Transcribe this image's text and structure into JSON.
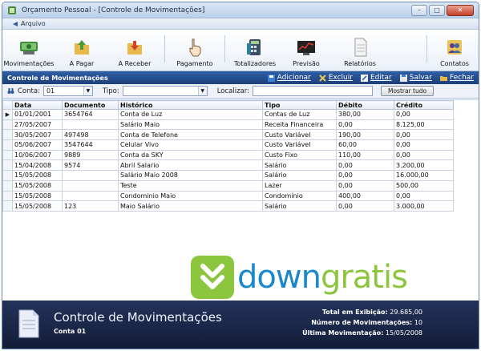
{
  "window": {
    "title": "Orçamento Pessoal - [Controle de Movimentações]",
    "min": "–",
    "max": "□",
    "close": "✕"
  },
  "menu": {
    "arquivo": "Arquivo"
  },
  "toolbar": {
    "buttons": [
      {
        "label": "Movimentações",
        "icon": "money-icon"
      },
      {
        "label": "A Pagar",
        "icon": "folder-up-icon"
      },
      {
        "label": "A Receber",
        "icon": "folder-down-icon"
      },
      {
        "label": "Pagamento",
        "icon": "hand-pointer-icon"
      },
      {
        "label": "Totalizadores",
        "icon": "calculator-icon"
      },
      {
        "label": "Previsão",
        "icon": "chart-screen-icon"
      },
      {
        "label": "Relatórios",
        "icon": "document-icon"
      },
      {
        "label": "Contatos",
        "icon": "contacts-icon"
      }
    ]
  },
  "section": {
    "title": "Controle de Movimentações",
    "actions": {
      "add": "Adicionar",
      "delete": "Excluir",
      "edit": "Editar",
      "save": "Salvar",
      "close": "Fechar"
    }
  },
  "filters": {
    "conta_label": "Conta:",
    "conta_value": "01",
    "tipo_label": "Tipo:",
    "tipo_value": "",
    "localizar_label": "Localizar:",
    "localizar_value": "",
    "show_all": "Mostrar tudo"
  },
  "grid": {
    "columns": [
      "Data",
      "Documento",
      "Histórico",
      "Tipo",
      "Débito",
      "Crédito"
    ],
    "rows": [
      [
        "01/01/2001",
        "3654764",
        "Conta de Luz",
        "Contas de Luz",
        "380,00",
        "0,00"
      ],
      [
        "27/05/2007",
        "",
        "Salário Maio",
        "Receita Financeira",
        "0,00",
        "8.125,00"
      ],
      [
        "30/05/2007",
        "497498",
        "Conta de Telefone",
        "Custo Variável",
        "190,00",
        "0,00"
      ],
      [
        "05/06/2007",
        "3547644",
        "Celular Vivo",
        "Custo Variável",
        "60,00",
        "0,00"
      ],
      [
        "10/06/2007",
        "9889",
        "Conta da SKY",
        "Custo Fixo",
        "110,00",
        "0,00"
      ],
      [
        "15/04/2008",
        "9574",
        "Abril Salario",
        "Salário",
        "0,00",
        "3.200,00"
      ],
      [
        "15/05/2008",
        "",
        "Salário Maio 2008",
        "Salário",
        "0,00",
        "16.000,00"
      ],
      [
        "15/05/2008",
        "",
        "Teste",
        "Lazer",
        "0,00",
        "500,00"
      ],
      [
        "15/05/2008",
        "",
        "Condominio Maio",
        "Condomínio",
        "400,00",
        "0,00"
      ],
      [
        "15/05/2008",
        "123",
        "Maio Salário",
        "Salário",
        "0,00",
        "3.000,00"
      ]
    ]
  },
  "footer": {
    "title": "Controle de Movimentações",
    "subtitle": "Conta 01",
    "total_label": "Total em Exibição:",
    "total_value": "29.685,00",
    "count_label": "Número de Movimentações:",
    "count_value": "10",
    "last_label": "Última Movimentação:",
    "last_value": "15/05/2008"
  },
  "watermark": {
    "part1": "down",
    "part2": "gratis"
  }
}
